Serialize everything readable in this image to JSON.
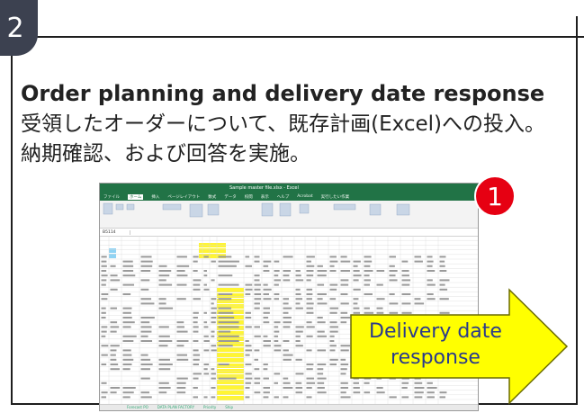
{
  "step": {
    "number": "2"
  },
  "section": {
    "title": "Order planning and delivery date response",
    "description": "受領したオーダーについて、既存計画(Excel)への投入。納期確認、および回答を実施。"
  },
  "callout_badge": {
    "number": "1"
  },
  "arrow": {
    "line1": "Delivery date",
    "line2": "response"
  },
  "colors": {
    "step_bg": "#3c4150",
    "badge": "#e60012",
    "arrow_fill": "#ffff00",
    "excel_green": "#217346"
  },
  "spreadsheet": {
    "title": "Sample master file.xlsx - Excel",
    "menu": [
      "ファイル",
      "ホーム",
      "挿入",
      "ページレイアウト",
      "数式",
      "データ",
      "校閲",
      "表示",
      "ヘルプ",
      "Acrobat",
      "実行したい作業"
    ],
    "active_menu_index": 1,
    "cell_ref": "B5114",
    "tabs": [
      "Forecast PO",
      "DATA PLAN FACTORY",
      "Priority",
      "Ship"
    ]
  }
}
